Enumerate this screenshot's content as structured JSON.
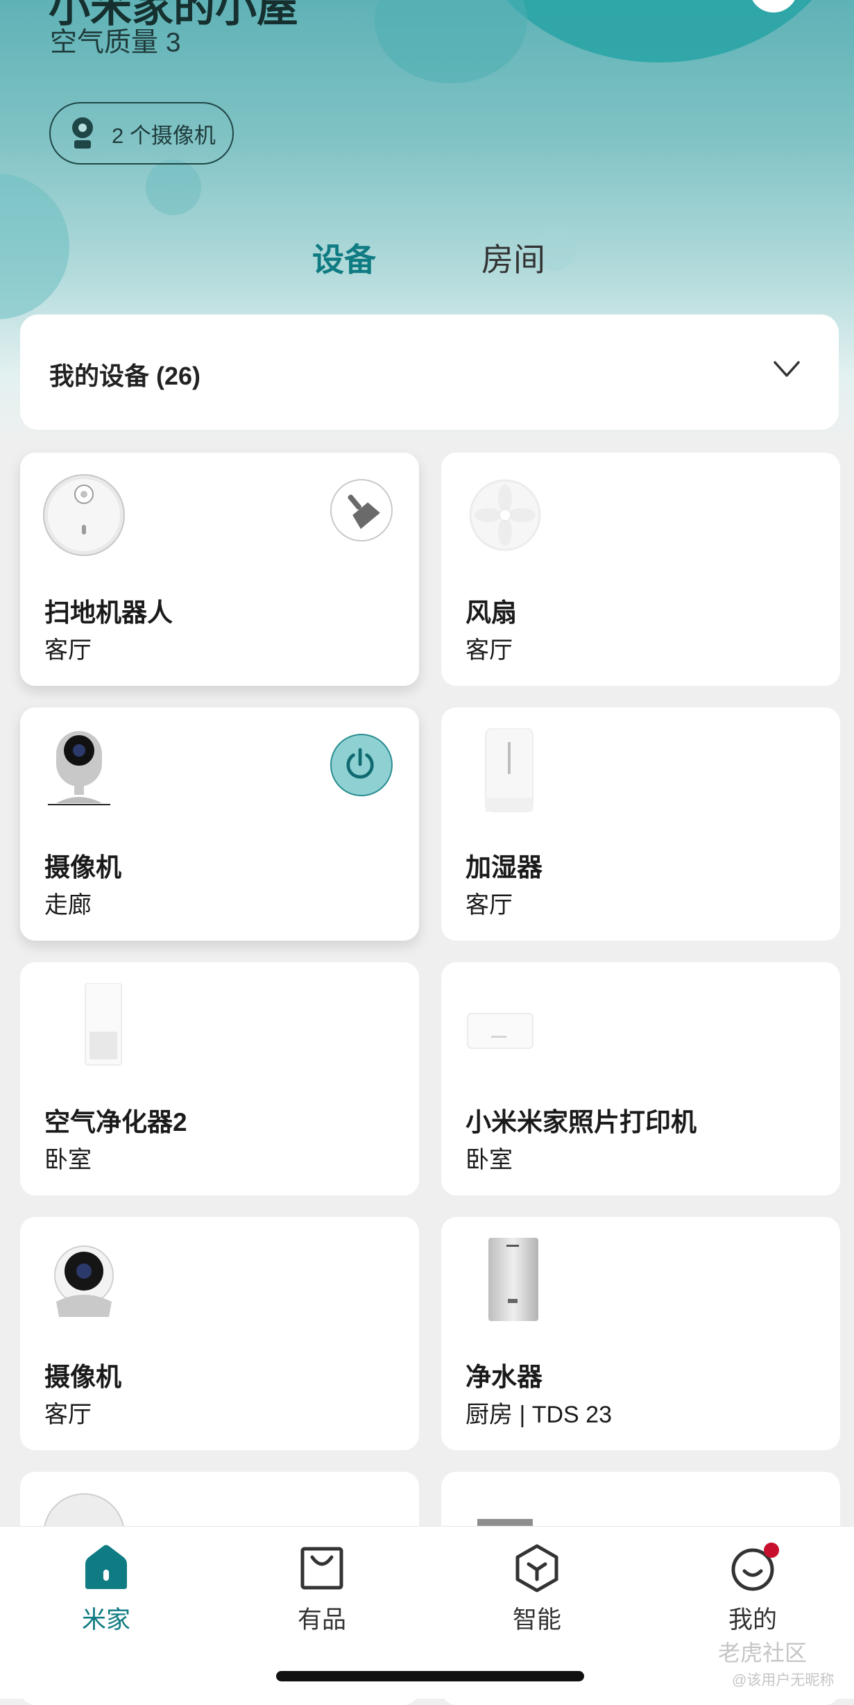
{
  "header": {
    "title": "小米家的小屋",
    "air_quality": "空气质量 3",
    "camera_pill": "2 个摄像机",
    "camera_icon": "camera-person-icon"
  },
  "tabs": [
    {
      "label": "设备",
      "active": true
    },
    {
      "label": "房间",
      "active": false
    }
  ],
  "devices_section": {
    "title": "我的设备 (26)",
    "toggle_icon": "chevron-down-icon"
  },
  "devices": [
    {
      "name": "扫地机器人",
      "room": "客厅",
      "action": "broom-icon"
    },
    {
      "name": "风扇",
      "room": "客厅"
    },
    {
      "name": "摄像机",
      "room": "走廊",
      "action": "power-icon"
    },
    {
      "name": "加湿器",
      "room": "客厅"
    },
    {
      "name": "空气净化器2",
      "room": "卧室"
    },
    {
      "name": "小米米家照片打印机",
      "room": "卧室"
    },
    {
      "name": "摄像机",
      "room": "客厅"
    },
    {
      "name": "净水器",
      "room": "厨房 | TDS 23"
    }
  ],
  "tabbar": [
    {
      "label": "米家",
      "icon": "home-icon",
      "active": true
    },
    {
      "label": "有品",
      "icon": "shopping-bag-icon",
      "active": false
    },
    {
      "label": "智能",
      "icon": "smart-cube-icon",
      "active": false
    },
    {
      "label": "我的",
      "icon": "smile-face-icon",
      "active": false,
      "badge": true
    }
  ],
  "colors": {
    "accent": "#0f7b82",
    "hero_teal": "#27a3a6",
    "badge_red": "#c8102e"
  },
  "watermark": {
    "brand": "老虎社区",
    "user": "@该用户无昵称"
  }
}
